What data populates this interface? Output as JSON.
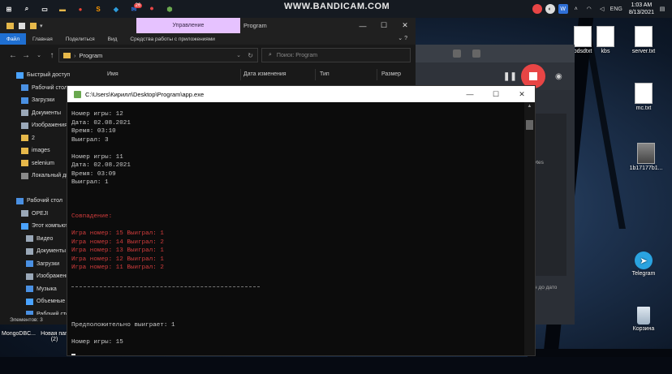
{
  "taskbar": {
    "watermark": "WWW.BANDICAM.COM",
    "apps": [
      {
        "name": "start-icon",
        "glyph": "⊞",
        "color": "#ffffff"
      },
      {
        "name": "search-icon",
        "glyph": "⌕",
        "color": "#ffffff"
      },
      {
        "name": "task-view-icon",
        "glyph": "▭",
        "color": "#ffffff"
      },
      {
        "name": "file-explorer-icon",
        "glyph": "▬",
        "color": "#e6b84a"
      },
      {
        "name": "chrome-icon",
        "glyph": "●",
        "color": "#ea4335"
      },
      {
        "name": "sublime-icon",
        "glyph": "S",
        "color": "#ff9800"
      },
      {
        "name": "vscode-icon",
        "glyph": "◆",
        "color": "#2d9cdb"
      },
      {
        "name": "mail-icon",
        "glyph": "✉",
        "color": "#2f6fd6"
      },
      {
        "name": "bandicam-record-icon",
        "glyph": "⏺",
        "color": "#e84545"
      },
      {
        "name": "app-icon",
        "glyph": "⬢",
        "color": "#6aa84f"
      }
    ],
    "badge": "26",
    "language": "ENG",
    "time": "1:03 AM",
    "date": "8/13/2021"
  },
  "explorer": {
    "manage_tab": "Управление",
    "title": "Program",
    "ribbon_tabs": [
      "Файл",
      "Главная",
      "Поделиться",
      "Вид",
      "Средства работы с приложениями"
    ],
    "path": "Program",
    "search_placeholder": "Поиск: Program",
    "columns": [
      "Имя",
      "Дата изменения",
      "Тип",
      "Размер"
    ],
    "nav_items": [
      {
        "label": "Быстрый доступ",
        "color": "#4aa3ff",
        "indent": 20
      },
      {
        "label": "Рабочий стол",
        "color": "#4a90e2",
        "indent": 26
      },
      {
        "label": "Загрузки",
        "color": "#4a90e2",
        "indent": 26
      },
      {
        "label": "Документы",
        "color": "#9aa8b8",
        "indent": 26
      },
      {
        "label": "Изображения",
        "color": "#9aa8b8",
        "indent": 26
      },
      {
        "label": "2",
        "color": "#e6b84a",
        "indent": 26
      },
      {
        "label": "images",
        "color": "#e6b84a",
        "indent": 26
      },
      {
        "label": "selenium",
        "color": "#e6b84a",
        "indent": 26
      },
      {
        "label": "Локальный ди",
        "color": "#8a8a8a",
        "indent": 26
      },
      {
        "label": "",
        "color": "",
        "indent": 0
      },
      {
        "label": "Рабочий стол",
        "color": "#4a90e2",
        "indent": 20
      },
      {
        "label": "OPEJI",
        "color": "#9aa8b8",
        "indent": 26
      },
      {
        "label": "Этот компьют",
        "color": "#4aa3ff",
        "indent": 26
      },
      {
        "label": "Видео",
        "color": "#9aa8b8",
        "indent": 32
      },
      {
        "label": "Документы",
        "color": "#9aa8b8",
        "indent": 32
      },
      {
        "label": "Загрузки",
        "color": "#4a90e2",
        "indent": 32
      },
      {
        "label": "Изображени",
        "color": "#9aa8b8",
        "indent": 32
      },
      {
        "label": "Музыка",
        "color": "#4a90e2",
        "indent": 32
      },
      {
        "label": "Объемные о",
        "color": "#4aa3ff",
        "indent": 32
      },
      {
        "label": "Рабочий сто",
        "color": "#4a90e2",
        "indent": 32
      }
    ],
    "status": "Элементов: 3"
  },
  "bandicam": {
    "label1": "ytes",
    "label2": "н до дато"
  },
  "console": {
    "title": "C:\\Users\\Кирилл\\Desktop\\Program\\app.exe",
    "block1": [
      "Номер игры: 12",
      "Дата: 02.08.2021",
      "Время: 03:10",
      "Выиграл: 3"
    ],
    "block2": [
      "Номер игры: 11",
      "Дата: 02.08.2021",
      "Время: 03:09",
      "Выиграл: 1"
    ],
    "match_header": "Совпадение:",
    "matches": [
      "Игра номер: 15 Выиграл: 1",
      "Игра номер: 14 Выиграл: 2",
      "Игра номер: 13 Выиграл: 1",
      "Игра номер: 12 Выиграл: 1",
      "Игра номер: 11 Выиграл: 2"
    ],
    "prediction": "Предположительно выиграет: 1",
    "next_game": "Номер игры: 15"
  },
  "desktop_icons": [
    {
      "label": "pdsdtxt",
      "type": "doc"
    },
    {
      "label": "kbs",
      "type": "doc"
    },
    {
      "label": "server.txt",
      "type": "doc"
    },
    {
      "label": "mc.txt",
      "type": "doc"
    },
    {
      "label": "1b17177b1...",
      "type": "img"
    },
    {
      "label": "Telegram",
      "type": "telegram"
    },
    {
      "label": "Корзина",
      "type": "trash"
    },
    {
      "label": "MongoDBC...",
      "type": "app"
    },
    {
      "label": "Новая пап",
      "type": "folder"
    },
    {
      "label": "(2)",
      "type": "none"
    }
  ]
}
